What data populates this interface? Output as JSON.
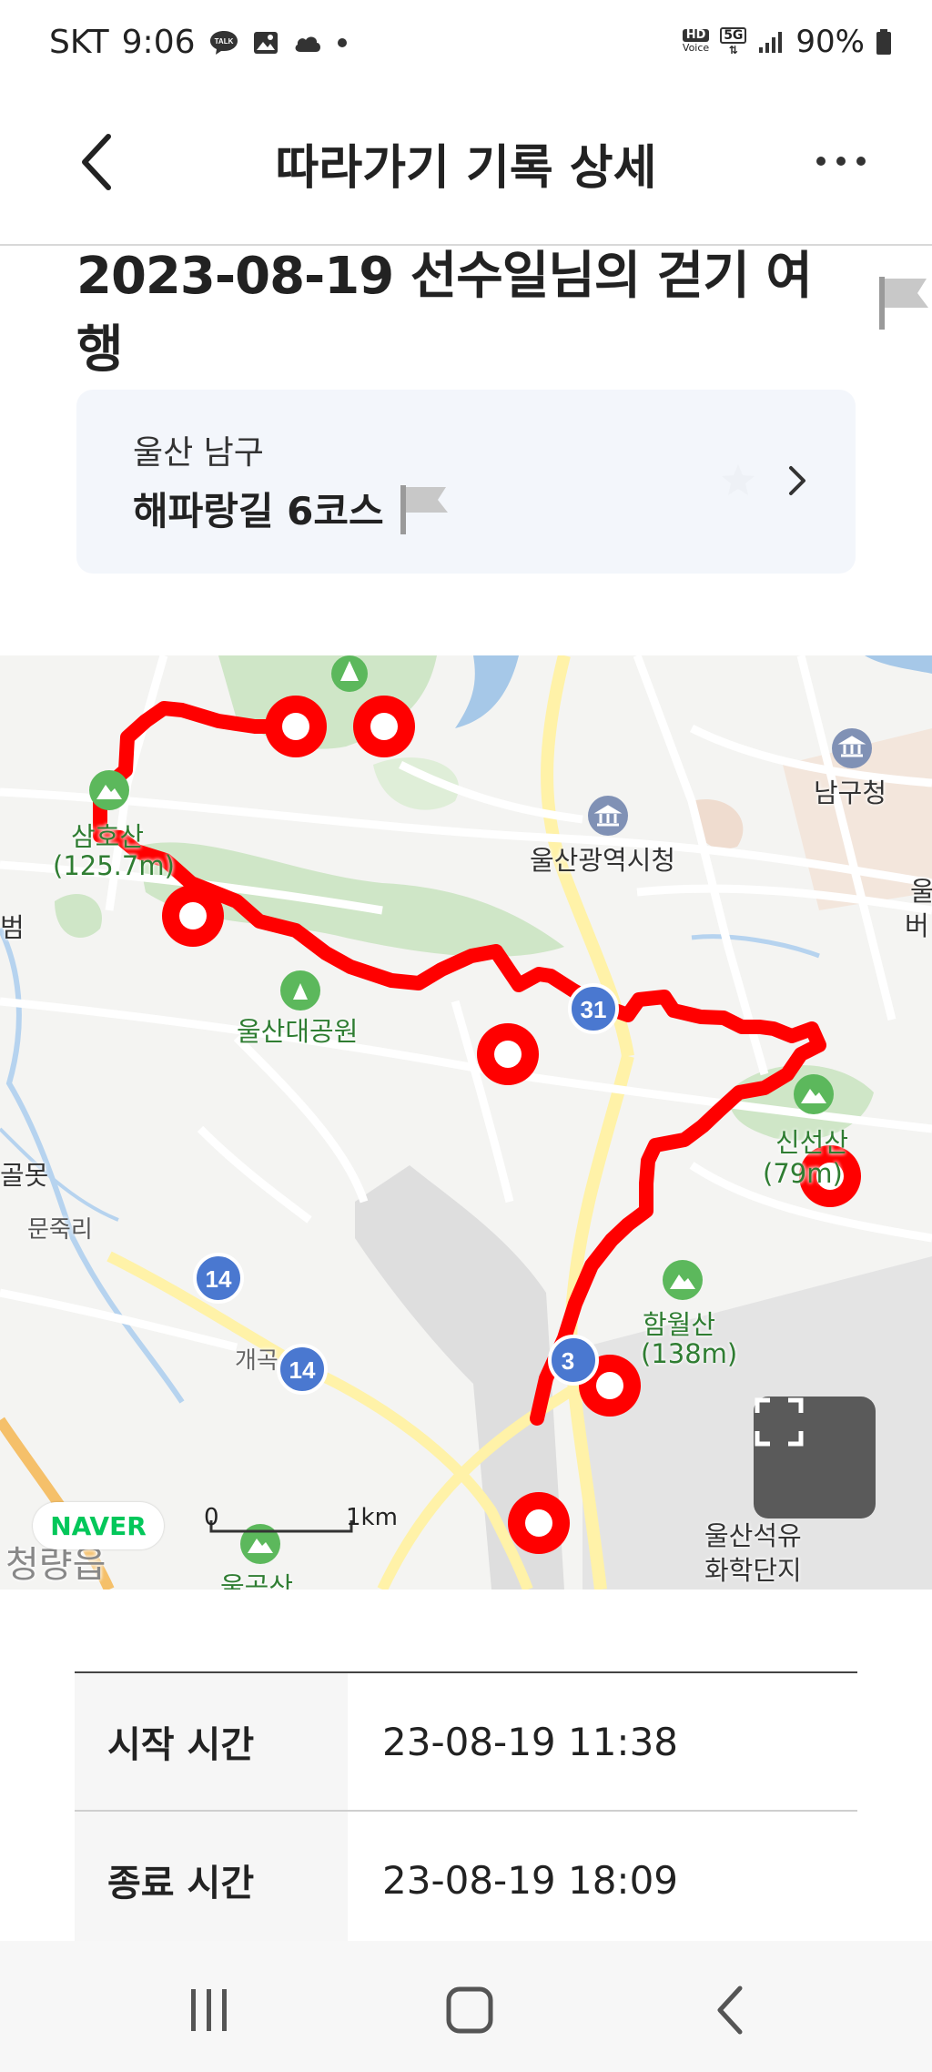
{
  "status_bar": {
    "carrier": "SKT",
    "time": "9:06",
    "talk_badge": "TALK",
    "hd_badge_top": "HD",
    "hd_badge_bottom": "Voice",
    "network": "5G",
    "battery": "90%"
  },
  "header": {
    "title": "따라가기 기록 상세"
  },
  "trip": {
    "title": "2023-08-19 선수일님의 걷기 여행"
  },
  "course": {
    "region": "울산 남구",
    "name": "해파랑길 6코스"
  },
  "map": {
    "labels": {
      "samho": "삼호산",
      "samho_height": "(125.7m)",
      "park": "울산대공원",
      "cityhall": "울산광역시청",
      "namgu": "남구청",
      "munjuk": "문죽리",
      "golmot": "골못",
      "hamwol": "함월산",
      "hamwol_height": "(138m)",
      "sinseon": "신선산",
      "sinseon_height": "(79m)",
      "gaegok": "개곡",
      "petro1": "울산석유",
      "petro2": "화학단지",
      "cheongryang": "청량읍",
      "ulgo": "울곡산",
      "edge_ul": "울",
      "edge_beo": "버",
      "edge_beom": "범",
      "road_31": "31",
      "road_14a": "14",
      "road_14b": "14",
      "road_3": "3"
    },
    "scale_zero": "0",
    "scale_km": "1km",
    "logo": "NAVER",
    "route_color": "#ff0000"
  },
  "times": [
    {
      "label": "시작 시간",
      "value": "23-08-19 11:38"
    },
    {
      "label": "종료 시간",
      "value": "23-08-19 18:09"
    }
  ]
}
